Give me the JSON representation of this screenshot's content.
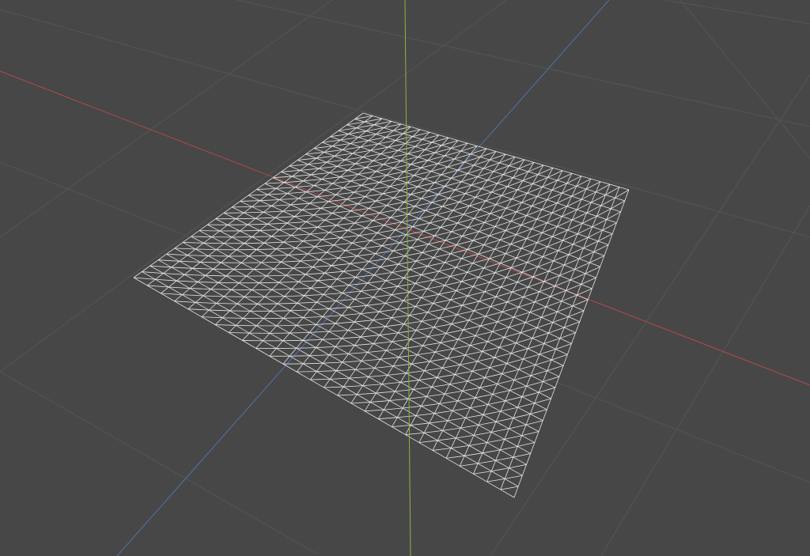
{
  "viewport": {
    "background_color": "#474747",
    "grid_line_color": "#555555",
    "axis_colors": {
      "x": "#b5484b",
      "y": "#8ab53a",
      "z": "#4f74a8"
    },
    "mesh": {
      "type": "triangulated-plane-wireframe",
      "subdivisions": 28,
      "wire_color": "#e6e6e6"
    }
  }
}
